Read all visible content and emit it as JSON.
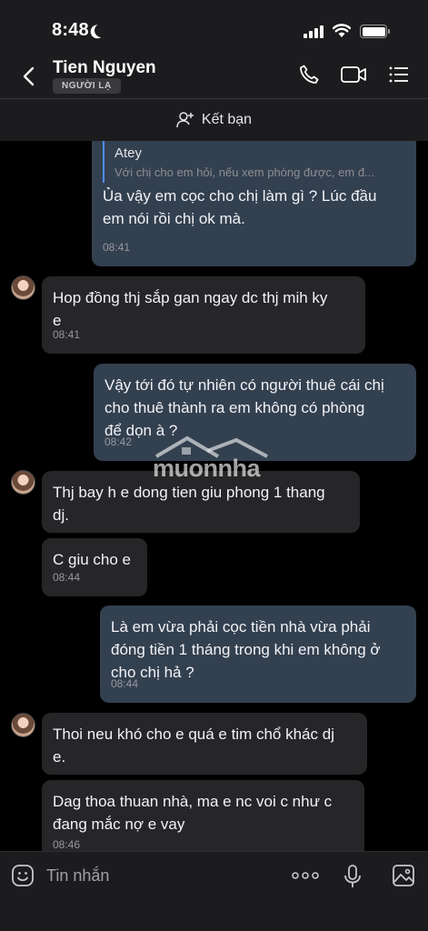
{
  "status_bar": {
    "time": "8:48"
  },
  "header": {
    "contact_name": "Tien Nguyen",
    "badge": "NGƯỜI LẠ"
  },
  "add_friend": {
    "label": "Kết bạn"
  },
  "messages": [
    {
      "direction": "out",
      "quote_author": "Atey",
      "quote_text": "Với chị cho em hỏi, nếu xem phòng được, em đ...",
      "lines": [
        "Ủa vậy em cọc cho chị làm gì ? Lúc đầu",
        "em nói rồi chị ok mà."
      ],
      "time": "08:41"
    },
    {
      "direction": "in",
      "lines": [
        "Hop đồng thj sắp gan ngay dc thj mih ky",
        "e"
      ],
      "time": "08:41"
    },
    {
      "direction": "out",
      "lines": [
        "Vậy tới đó tự nhiên có người thuê cái chị",
        "cho thuê thành ra em không có phòng",
        "để dọn à ?"
      ],
      "time": "08:42"
    },
    {
      "direction": "in",
      "lines": [
        "Thj bay h e dong tien giu phong 1 thang",
        "dj."
      ]
    },
    {
      "direction": "in",
      "lines": [
        "C giu cho e"
      ],
      "time": "08:44"
    },
    {
      "direction": "out",
      "lines": [
        "Là em vừa phải cọc tiền nhà vừa phải",
        "đóng tiền 1 tháng trong khi em không ở",
        "cho chị hả ?"
      ],
      "time": "08:44"
    },
    {
      "direction": "in",
      "lines": [
        "Thoi neu khó cho e quá e tim chổ khác dj",
        "e."
      ]
    },
    {
      "direction": "in",
      "lines": [
        "Dag thoa thuan nhà, ma e nc voi c như c",
        "đang mắc nợ e vay"
      ],
      "time": "08:46"
    }
  ],
  "watermark": {
    "text": "muonnha"
  },
  "input": {
    "placeholder": "Tin nhắn"
  }
}
